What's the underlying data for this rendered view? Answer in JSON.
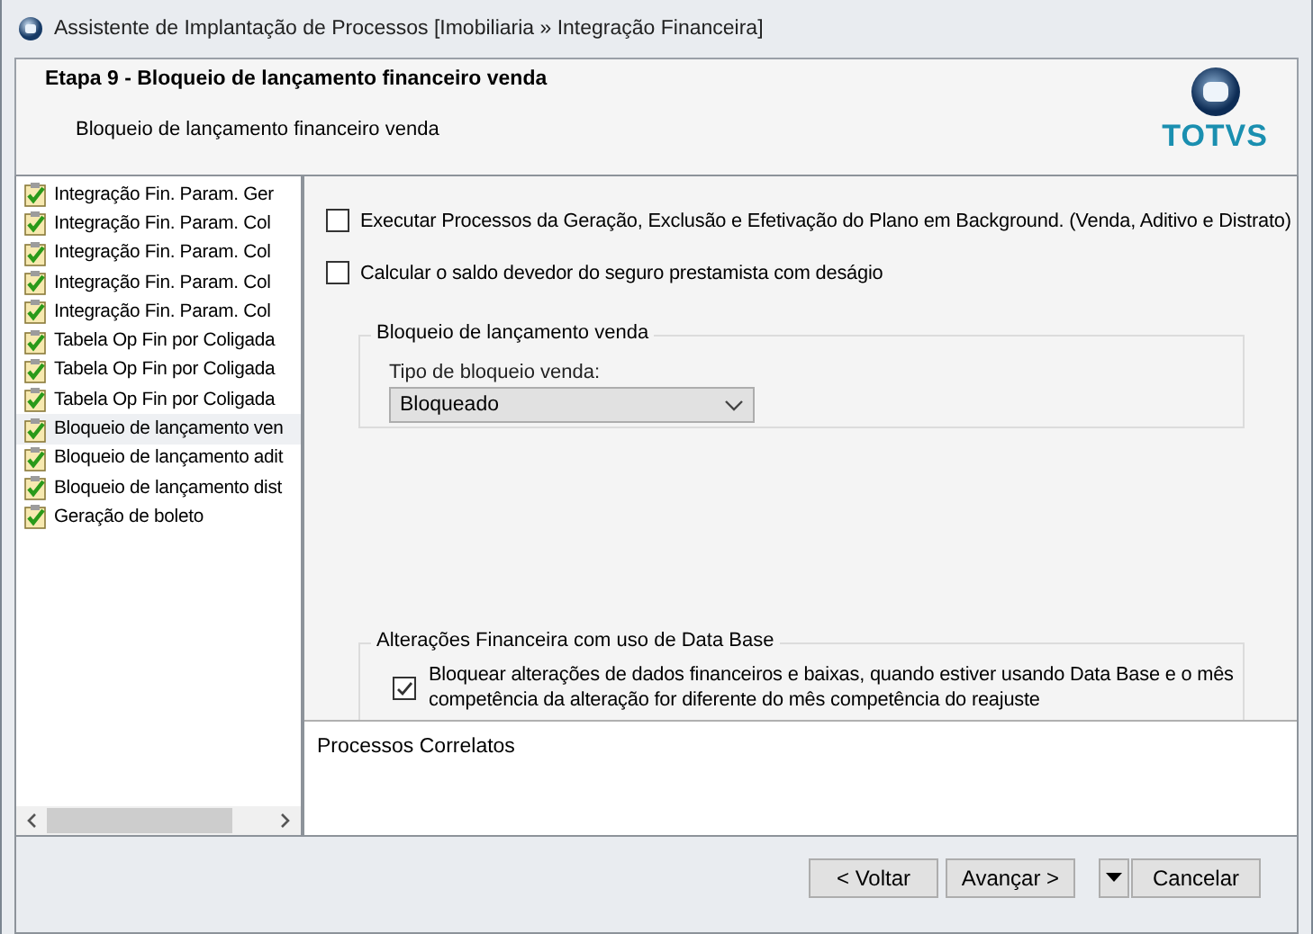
{
  "window": {
    "title": "Assistente de Implantação de Processos [Imobiliaria » Integração Financeira]"
  },
  "header": {
    "title": "Etapa 9 - Bloqueio de lançamento financeiro venda",
    "subtitle": "Bloqueio de lançamento financeiro venda",
    "logo": "TOTVS"
  },
  "steps": [
    {
      "label": "Integração Fin. Param. Ger",
      "selected": false
    },
    {
      "label": "Integração Fin. Param. Col",
      "selected": false
    },
    {
      "label": "Integração Fin. Param. Col",
      "selected": false
    },
    {
      "label": "Integração Fin. Param. Col",
      "selected": false
    },
    {
      "label": "Integração Fin. Param. Col",
      "selected": false
    },
    {
      "label": "Tabela Op Fin por Coligada",
      "selected": false
    },
    {
      "label": "Tabela Op Fin por Coligada",
      "selected": false
    },
    {
      "label": "Tabela Op Fin por Coligada",
      "selected": false
    },
    {
      "label": "Bloqueio de lançamento ven",
      "selected": true
    },
    {
      "label": "Bloqueio de lançamento adit",
      "selected": false
    },
    {
      "label": "Bloqueio de lançamento dist",
      "selected": false
    },
    {
      "label": "Geração de boleto",
      "selected": false
    }
  ],
  "options": [
    {
      "label": "Executar Processos da Geração, Exclusão e Efetivação do Plano em Background. (Venda, Aditivo e Distrato)",
      "checked": false
    },
    {
      "label": "Calcular o saldo devedor do seguro prestamista com deságio",
      "checked": false
    }
  ],
  "group_sale": {
    "title": "Bloqueio de lançamento venda",
    "field_label": "Tipo de bloqueio venda:",
    "value": "Bloqueado"
  },
  "group_database": {
    "title": "Alterações Financeira com uso de Data Base",
    "option": {
      "label": "Bloquear alterações de dados financeiros e baixas, quando estiver usando Data Base e o mês competência da alteração for diferente do mês competência do reajuste",
      "checked": true
    }
  },
  "related": {
    "title": "Processos Correlatos"
  },
  "buttons": {
    "back": "< Voltar",
    "next": "Avançar >",
    "cancel": "Cancelar"
  }
}
